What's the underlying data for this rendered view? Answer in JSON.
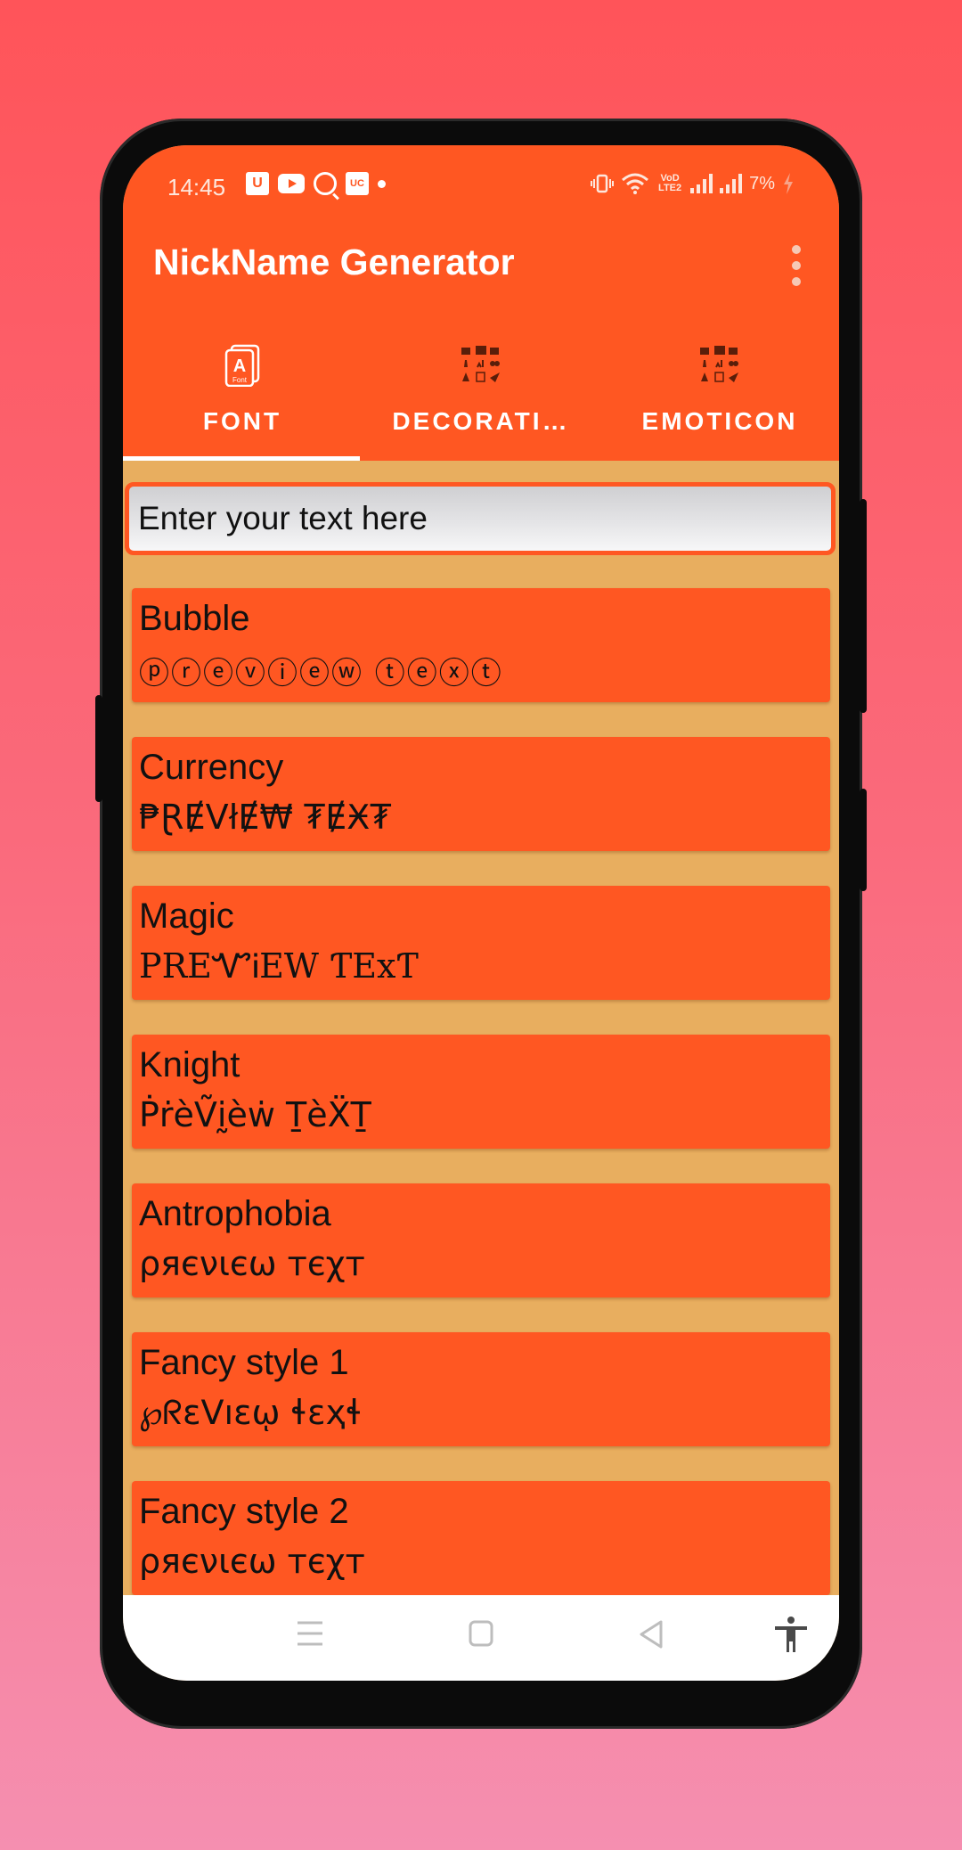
{
  "status_bar": {
    "time": "14:45",
    "left_icons": [
      "u-app-icon",
      "youtube-icon",
      "search-q-icon",
      "uc-browser-icon",
      "notification-dot-icon"
    ],
    "u_label": "U",
    "uc_label": "UC",
    "right_icons": [
      "vibrate-icon",
      "wifi-icon",
      "volte-icon",
      "signal-icon",
      "signal-icon",
      "charging-icon"
    ],
    "volte_label": "VoD LTE2",
    "battery": "7%"
  },
  "app_bar": {
    "title": "NickName Generator",
    "menu_icon": "overflow-menu-icon"
  },
  "tabs": [
    {
      "label": "FONT",
      "icon": "font-icon",
      "selected": true
    },
    {
      "label": "DECORATI…",
      "icon": "decoration-grid-icon",
      "selected": false
    },
    {
      "label": "EMOTICON",
      "icon": "emoticon-grid-icon",
      "selected": false
    }
  ],
  "input": {
    "placeholder": "Enter your text here",
    "value": ""
  },
  "styles": [
    {
      "name": "Bubble",
      "preview": "ⓟⓡⓔⓥⓘⓔⓦ ⓣⓔⓧⓣ"
    },
    {
      "name": "Currency",
      "preview": "₱ⱤɆVłɆ₩ ₮ɆӾ₮"
    },
    {
      "name": "Magic",
      "preview": "PREᏉᎥEW ƬExƬ"
    },
    {
      "name": "Knight",
      "preview": "ṖṙèṼḭèẇ ṮèẌṮ"
    },
    {
      "name": "Antrophobia",
      "preview": "ρяєνιєω тєχт"
    },
    {
      "name": "Fancy style 1",
      "preview": "℘ᖇɛᐯıɛῳ ɬɛҳɬ"
    },
    {
      "name": "Fancy style 2",
      "preview": "ρяєνιєω тєχт"
    }
  ],
  "nav_bar": {
    "buttons": [
      "recents-icon",
      "home-icon",
      "back-icon",
      "accessibility-icon"
    ]
  },
  "colors": {
    "primary": "#FF5722",
    "content_background": "#E8AE5F",
    "text": "#111111"
  }
}
